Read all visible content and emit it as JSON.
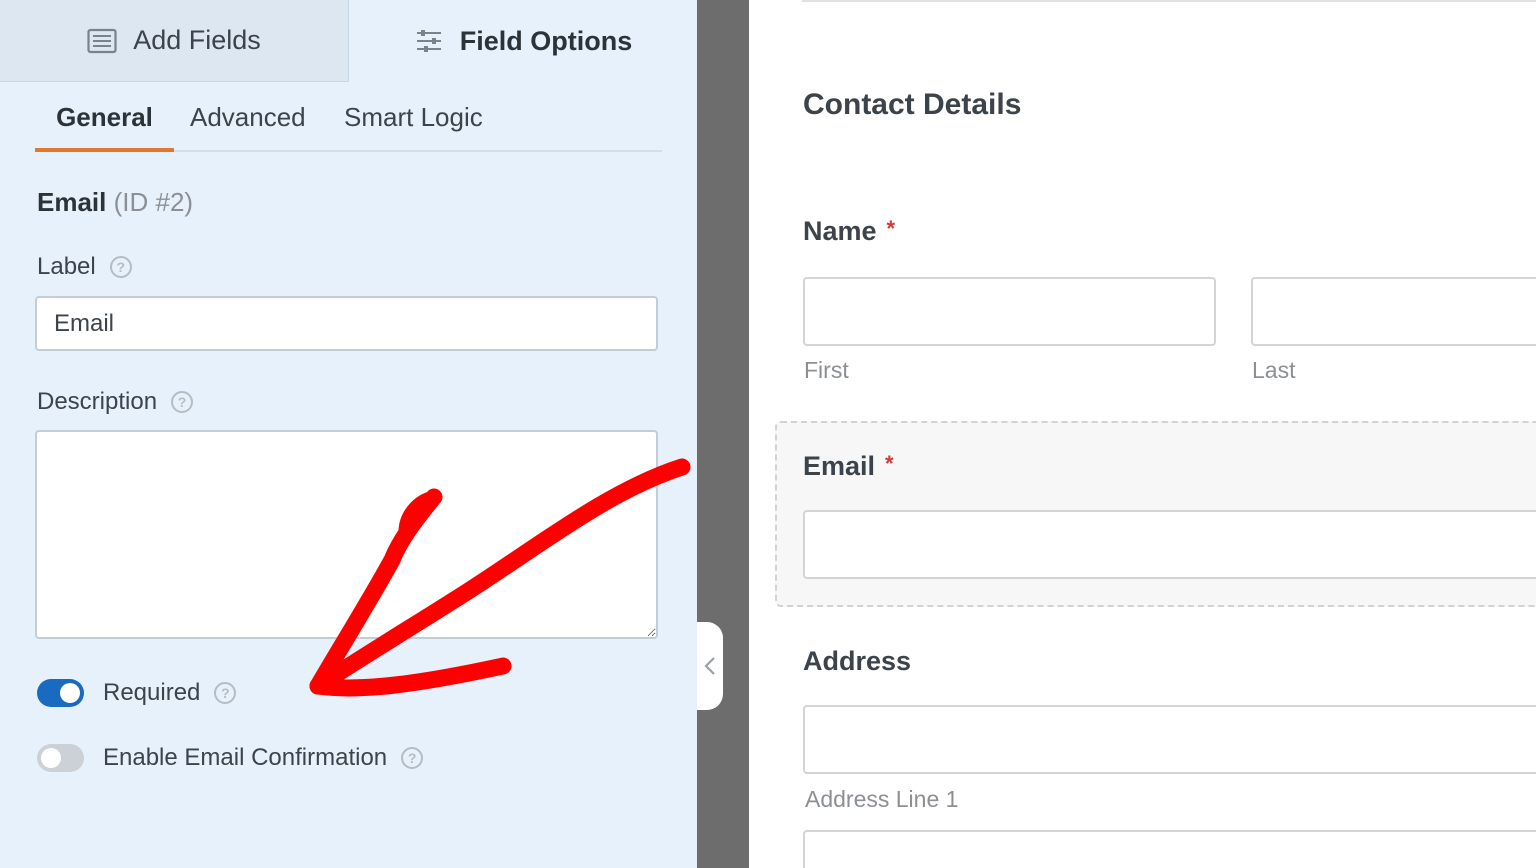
{
  "left_panel": {
    "tabs": {
      "add_fields": "Add Fields",
      "field_options": "Field Options"
    },
    "sub_tabs": {
      "general": "General",
      "advanced": "Advanced",
      "smart_logic": "Smart Logic"
    },
    "field_name": "Email",
    "field_id": "(ID #2)",
    "label_caption": "Label",
    "label_value": "Email",
    "description_caption": "Description",
    "description_value": "",
    "required_label": "Required",
    "required_on": true,
    "email_confirmation_label": "Enable Email Confirmation",
    "email_confirmation_on": false
  },
  "preview": {
    "section_title": "Contact Details",
    "name_label": "Name",
    "required_mark": "*",
    "first_sublabel": "First",
    "last_sublabel": "Last",
    "email_label": "Email",
    "address_label": "Address",
    "address_line1_sublabel": "Address Line 1"
  },
  "colors": {
    "panel_bg": "#e7f1fb",
    "active_tab_underline": "#e27730",
    "toggle_on": "#1a6bc0",
    "required_star": "#d63638",
    "annotation_arrow": "#ff0000"
  }
}
